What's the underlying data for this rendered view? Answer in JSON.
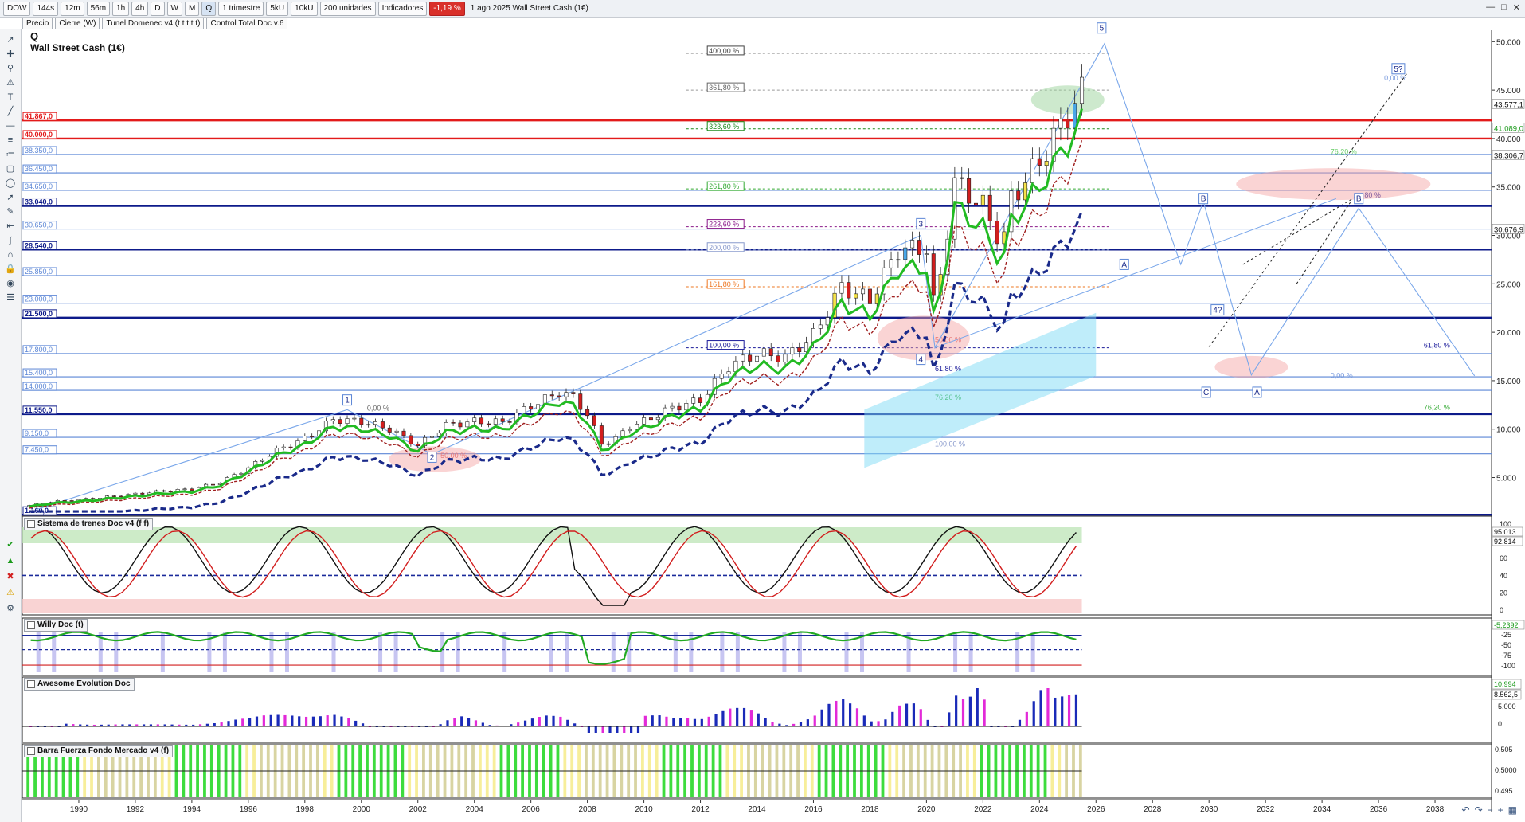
{
  "toolbar": {
    "symbol": "DOW",
    "timeframes": [
      "144s",
      "12m",
      "56m",
      "1h",
      "4h",
      "D",
      "W",
      "M",
      "Q"
    ],
    "selected_timeframe": "Q",
    "period": "1 trimestre",
    "units_a": "5kU",
    "units_b": "10kU",
    "units_c": "200 unidades",
    "indicators": "Indicadores",
    "change": "-1,19 %",
    "date_title": "1 ago 2025 Wall Street Cash (1€)"
  },
  "toolbar2": [
    "Precio",
    "Cierre (W)",
    "Tunel Domenec v4 (t t t t t)",
    "Control Total Doc v.6"
  ],
  "title": {
    "symbol": "Q",
    "name": "Wall Street Cash (1€)"
  },
  "left_levels": [
    {
      "label": "41.867,0",
      "value": 41867,
      "color": "#e31a1a"
    },
    {
      "label": "40.000,0",
      "value": 40000,
      "color": "#e31a1a"
    },
    {
      "label": "38.350,0",
      "value": 38350,
      "color": "#5b86d6"
    },
    {
      "label": "36.450,0",
      "value": 36450,
      "color": "#5b86d6"
    },
    {
      "label": "34.650,0",
      "value": 34650,
      "color": "#5b86d6"
    },
    {
      "label": "33.040,0",
      "value": 33040,
      "color": "#0d1a8a"
    },
    {
      "label": "30.650,0",
      "value": 30650,
      "color": "#5b86d6"
    },
    {
      "label": "28.540,0",
      "value": 28540,
      "color": "#0d1a8a"
    },
    {
      "label": "25.850,0",
      "value": 25850,
      "color": "#5b86d6"
    },
    {
      "label": "23.000,0",
      "value": 23000,
      "color": "#5b86d6"
    },
    {
      "label": "21.500,0",
      "value": 21500,
      "color": "#0d1a8a"
    },
    {
      "label": "17.800,0",
      "value": 17800,
      "color": "#5b86d6"
    },
    {
      "label": "15.400,0",
      "value": 15400,
      "color": "#5b86d6"
    },
    {
      "label": "14.000,0",
      "value": 14000,
      "color": "#5b86d6"
    },
    {
      "label": "11.550,0",
      "value": 11550,
      "color": "#0d1a8a"
    },
    {
      "label": "9.150,0",
      "value": 9150,
      "color": "#5b86d6"
    },
    {
      "label": "7.450,0",
      "value": 7450,
      "color": "#5b86d6"
    },
    {
      "label": "1.160,0",
      "value": 1160,
      "color": "#0d1a8a"
    }
  ],
  "fib_labels": [
    {
      "text": "400,00 %",
      "year": 2012.3,
      "value": 48800,
      "color": "#444"
    },
    {
      "text": "361,80 %",
      "year": 2012.3,
      "value": 45000,
      "color": "#666"
    },
    {
      "text": "323,60 %",
      "year": 2012.3,
      "value": 41000,
      "color": "#1a8a1a"
    },
    {
      "text": "261,80 %",
      "year": 2012.3,
      "value": 34800,
      "color": "#33aa33"
    },
    {
      "text": "223,60 %",
      "year": 2012.3,
      "value": 30900,
      "color": "#8a1a8a"
    },
    {
      "text": "200,00 %",
      "year": 2012.3,
      "value": 28500,
      "color": "#8899cc"
    },
    {
      "text": "161,80 %",
      "year": 2012.3,
      "value": 24700,
      "color": "#ee7722"
    },
    {
      "text": "100,00 %",
      "year": 2012.3,
      "value": 18400,
      "color": "#1a1a9a"
    },
    {
      "text": "0,00 %",
      "year": 2000.2,
      "value": 11900,
      "color": "#666"
    },
    {
      "text": "50,00 %",
      "year": 2002.8,
      "value": 7000,
      "color": "#dd5555"
    },
    {
      "text": "50,00 %",
      "year": 2020.3,
      "value": 19000,
      "color": "#dd5555"
    },
    {
      "text": "61,80 %",
      "year": 2020.3,
      "value": 16000,
      "color": "#1a1a9a"
    },
    {
      "text": "76,20 %",
      "year": 2020.3,
      "value": 13000,
      "color": "#33aa33"
    },
    {
      "text": "100,00 %",
      "year": 2020.3,
      "value": 8200,
      "color": "#8899cc"
    },
    {
      "text": "0,00 %",
      "year": 2036.2,
      "value": 46000,
      "color": "#7799dd"
    },
    {
      "text": "76,20 %",
      "year": 2034.3,
      "value": 38400,
      "color": "#66cc66"
    },
    {
      "text": "80 %",
      "year": 2035.5,
      "value": 33900,
      "color": "#1a1a9a"
    },
    {
      "text": "0,00 %",
      "year": 2034.3,
      "value": 15300,
      "color": "#7799dd"
    },
    {
      "text": "61,80 %",
      "year": 2037.6,
      "value": 18400,
      "color": "#1a1a9a"
    },
    {
      "text": "76,20 %",
      "year": 2037.6,
      "value": 12000,
      "color": "#33aa33"
    }
  ],
  "wave_labels": [
    {
      "text": "1",
      "year": 1999.5,
      "value": 12800
    },
    {
      "text": "2",
      "year": 2002.5,
      "value": 6900
    },
    {
      "text": "3",
      "year": 2019.8,
      "value": 31000
    },
    {
      "text": "4",
      "year": 2019.8,
      "value": 17000
    },
    {
      "text": "5",
      "year": 2026.2,
      "value": 51200
    },
    {
      "text": "5?",
      "year": 2036.7,
      "value": 47000
    },
    {
      "text": "B",
      "year": 2029.8,
      "value": 33600
    },
    {
      "text": "A",
      "year": 2027.0,
      "value": 26800
    },
    {
      "text": "4?",
      "year": 2030.3,
      "value": 22100
    },
    {
      "text": "C",
      "year": 2029.9,
      "value": 13600
    },
    {
      "text": "A",
      "year": 2031.7,
      "value": 13600
    },
    {
      "text": "B",
      "year": 2035.3,
      "value": 33600
    }
  ],
  "right_axis": {
    "ticks": [
      "50.000",
      "45.000",
      "40.000",
      "35.000",
      "30.000",
      "25.000",
      "20.000",
      "15.000",
      "10.000",
      "5.000"
    ],
    "tick_values": [
      50000,
      45000,
      40000,
      35000,
      30000,
      25000,
      20000,
      15000,
      10000,
      5000
    ],
    "badges": [
      {
        "text": "43.577,1",
        "value": 43577,
        "color": "#ffffff",
        "fg": "#111"
      },
      {
        "text": "41.089,0",
        "value": 41089,
        "color": "#ffffff",
        "fg": "#1a9a1a"
      },
      {
        "text": "38.306,7",
        "value": 38306,
        "color": "#ffffff",
        "fg": "#111"
      },
      {
        "text": "30.676,9",
        "value": 30676,
        "color": "#ffffff",
        "fg": "#111"
      }
    ]
  },
  "x_axis": {
    "years": [
      "1990",
      "1992",
      "1994",
      "1996",
      "1998",
      "2000",
      "2002",
      "2004",
      "2006",
      "2008",
      "2010",
      "2012",
      "2014",
      "2016",
      "2018",
      "2020",
      "2022",
      "2024",
      "2026",
      "2028",
      "2030",
      "2032",
      "2034",
      "2036",
      "2038"
    ]
  },
  "panels": {
    "trenes": {
      "title": "Sistema de trenes Doc v4 (f f)",
      "ticks": [
        "100",
        "80",
        "60",
        "40",
        "20",
        "0"
      ],
      "badges": [
        "95,013",
        "92,814"
      ]
    },
    "willy": {
      "title": "Willy Doc (t)",
      "ticks": [
        "-25",
        "-50",
        "-75",
        "-100"
      ],
      "badges": [
        "-5,2392"
      ]
    },
    "awesome": {
      "title": "Awesome Evolution Doc",
      "ticks": [
        "5.000",
        "0"
      ],
      "badges": [
        "10.994",
        "8.562,5"
      ]
    },
    "barra": {
      "title": "Barra Fuerza Fondo Mercado v4 (f)",
      "ticks": [
        "0,505",
        "0,5000",
        "0,495"
      ]
    }
  },
  "colors": {
    "up_candle": "#ffffff",
    "down_candle": "#d21e1e",
    "yellow_candle": "#f5e34a",
    "blue_candle": "#4aa7e8",
    "green_line": "#22bb22",
    "navy_dotted": "#1a2a8a",
    "red_dashed": "#a02020",
    "toolbar_bg": "#eef1f5"
  },
  "chart_data": {
    "type": "line",
    "title": "Wall Street Cash (1€)",
    "xlabel": "",
    "ylabel": "",
    "xlim": [
      1988,
      2040
    ],
    "ylim": [
      1000,
      52000
    ],
    "series": [
      {
        "name": "",
        "x": [
          1988,
          1989,
          1990,
          1991,
          1992,
          1993,
          1994,
          1995,
          1996,
          1997,
          1998,
          1999,
          2000,
          2001,
          2002,
          2003,
          2004,
          2005,
          2006,
          2007,
          2007.5,
          2008,
          2008.5,
          2009,
          2009.5,
          2010,
          2011,
          2012,
          2013,
          2014,
          2015,
          2016,
          2017,
          2018,
          2019,
          2020,
          2020.3,
          2021,
          2022,
          2022.7,
          2023,
          2024,
          2025,
          2025.5
        ],
        "values": [
          2000,
          2500,
          2700,
          3000,
          3300,
          3600,
          3800,
          4500,
          6000,
          7800,
          9000,
          11000,
          10800,
          10000,
          8300,
          10400,
          10800,
          10700,
          12400,
          13800,
          13300,
          11500,
          8500,
          9000,
          10300,
          10800,
          12200,
          13000,
          16500,
          17800,
          17400,
          19700,
          24700,
          23300,
          28500,
          28700,
          22000,
          35500,
          33000,
          29000,
          33800,
          37600,
          42500,
          44800
        ]
      }
    ]
  }
}
